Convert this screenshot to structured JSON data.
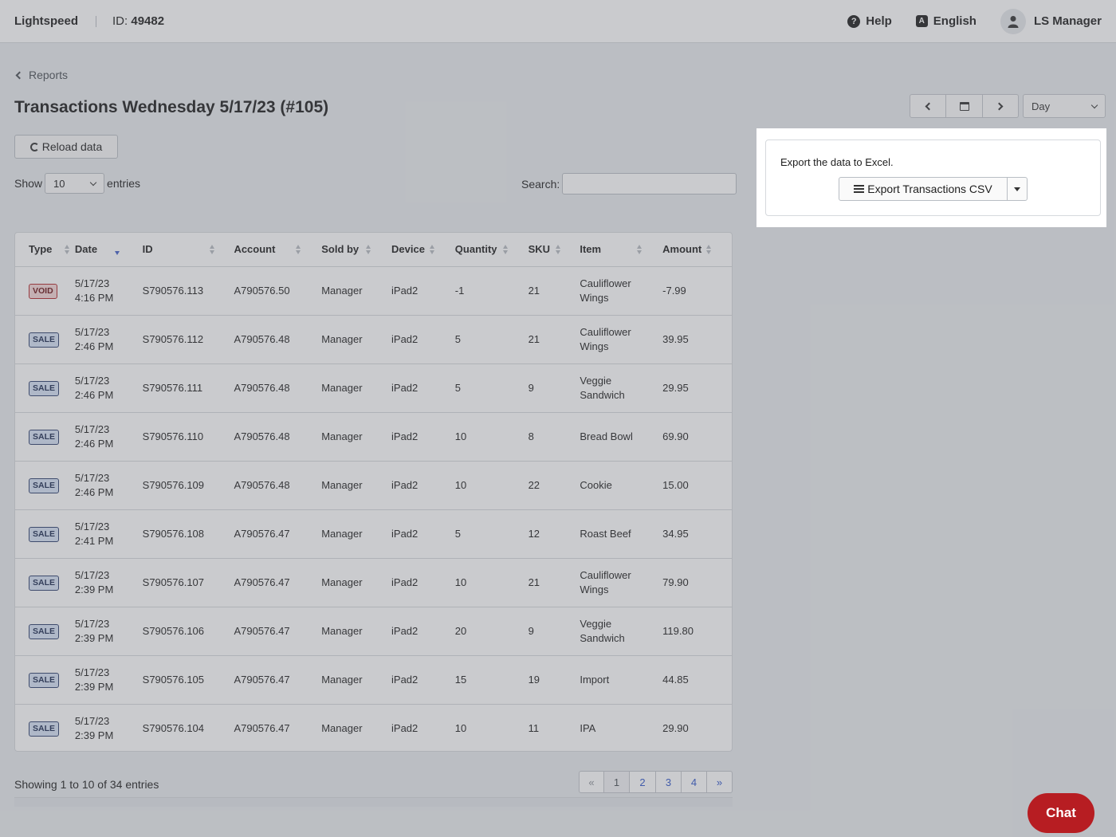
{
  "header": {
    "brand": "Lightspeed",
    "id_label": "ID:",
    "id_value": "49482",
    "help_label": "Help",
    "language_label": "English",
    "user_label": "LS Manager"
  },
  "breadcrumb": {
    "back_label": "Reports"
  },
  "page": {
    "title": "Transactions Wednesday 5/17/23 (#105)"
  },
  "date_nav": {
    "period_value": "Day"
  },
  "toolbar": {
    "reload_label": "Reload data"
  },
  "list_controls": {
    "show_label": "Show",
    "entries_value": "10",
    "entries_label": "entries",
    "search_label": "Search:",
    "search_value": ""
  },
  "table": {
    "columns": [
      "Type",
      "Date",
      "ID",
      "Account",
      "Sold by",
      "Device",
      "Quantity",
      "SKU",
      "Item",
      "Amount"
    ],
    "rows": [
      {
        "type": "VOID",
        "date": "5/17/23",
        "time": "4:16 PM",
        "id": "S790576.113",
        "account": "A790576.50",
        "sold_by": "Manager",
        "device": "iPad2",
        "quantity": "-1",
        "sku": "21",
        "item": "Cauliflower Wings",
        "amount": "-7.99"
      },
      {
        "type": "SALE",
        "date": "5/17/23",
        "time": "2:46 PM",
        "id": "S790576.112",
        "account": "A790576.48",
        "sold_by": "Manager",
        "device": "iPad2",
        "quantity": "5",
        "sku": "21",
        "item": "Cauliflower Wings",
        "amount": "39.95"
      },
      {
        "type": "SALE",
        "date": "5/17/23",
        "time": "2:46 PM",
        "id": "S790576.111",
        "account": "A790576.48",
        "sold_by": "Manager",
        "device": "iPad2",
        "quantity": "5",
        "sku": "9",
        "item": "Veggie Sandwich",
        "amount": "29.95"
      },
      {
        "type": "SALE",
        "date": "5/17/23",
        "time": "2:46 PM",
        "id": "S790576.110",
        "account": "A790576.48",
        "sold_by": "Manager",
        "device": "iPad2",
        "quantity": "10",
        "sku": "8",
        "item": "Bread Bowl",
        "amount": "69.90"
      },
      {
        "type": "SALE",
        "date": "5/17/23",
        "time": "2:46 PM",
        "id": "S790576.109",
        "account": "A790576.48",
        "sold_by": "Manager",
        "device": "iPad2",
        "quantity": "10",
        "sku": "22",
        "item": "Cookie",
        "amount": "15.00"
      },
      {
        "type": "SALE",
        "date": "5/17/23",
        "time": "2:41 PM",
        "id": "S790576.108",
        "account": "A790576.47",
        "sold_by": "Manager",
        "device": "iPad2",
        "quantity": "5",
        "sku": "12",
        "item": "Roast Beef",
        "amount": "34.95"
      },
      {
        "type": "SALE",
        "date": "5/17/23",
        "time": "2:39 PM",
        "id": "S790576.107",
        "account": "A790576.47",
        "sold_by": "Manager",
        "device": "iPad2",
        "quantity": "10",
        "sku": "21",
        "item": "Cauliflower Wings",
        "amount": "79.90"
      },
      {
        "type": "SALE",
        "date": "5/17/23",
        "time": "2:39 PM",
        "id": "S790576.106",
        "account": "A790576.47",
        "sold_by": "Manager",
        "device": "iPad2",
        "quantity": "20",
        "sku": "9",
        "item": "Veggie Sandwich",
        "amount": "119.80"
      },
      {
        "type": "SALE",
        "date": "5/17/23",
        "time": "2:39 PM",
        "id": "S790576.105",
        "account": "A790576.47",
        "sold_by": "Manager",
        "device": "iPad2",
        "quantity": "15",
        "sku": "19",
        "item": "Import",
        "amount": "44.85"
      },
      {
        "type": "SALE",
        "date": "5/17/23",
        "time": "2:39 PM",
        "id": "S790576.104",
        "account": "A790576.47",
        "sold_by": "Manager",
        "device": "iPad2",
        "quantity": "10",
        "sku": "11",
        "item": "IPA",
        "amount": "29.90"
      }
    ]
  },
  "footer": {
    "showing_text": "Showing 1 to 10 of 34 entries",
    "pagination": [
      "«",
      "1",
      "2",
      "3",
      "4",
      "»"
    ],
    "current_page": "1"
  },
  "export_panel": {
    "description": "Export the data to Excel.",
    "button_label": "Export Transactions CSV"
  },
  "chat": {
    "label": "Chat"
  },
  "colors": {
    "accent": "#2f55c8",
    "chat": "#b71d22",
    "void": "#b1262a",
    "sale": "#2d3f6d"
  }
}
